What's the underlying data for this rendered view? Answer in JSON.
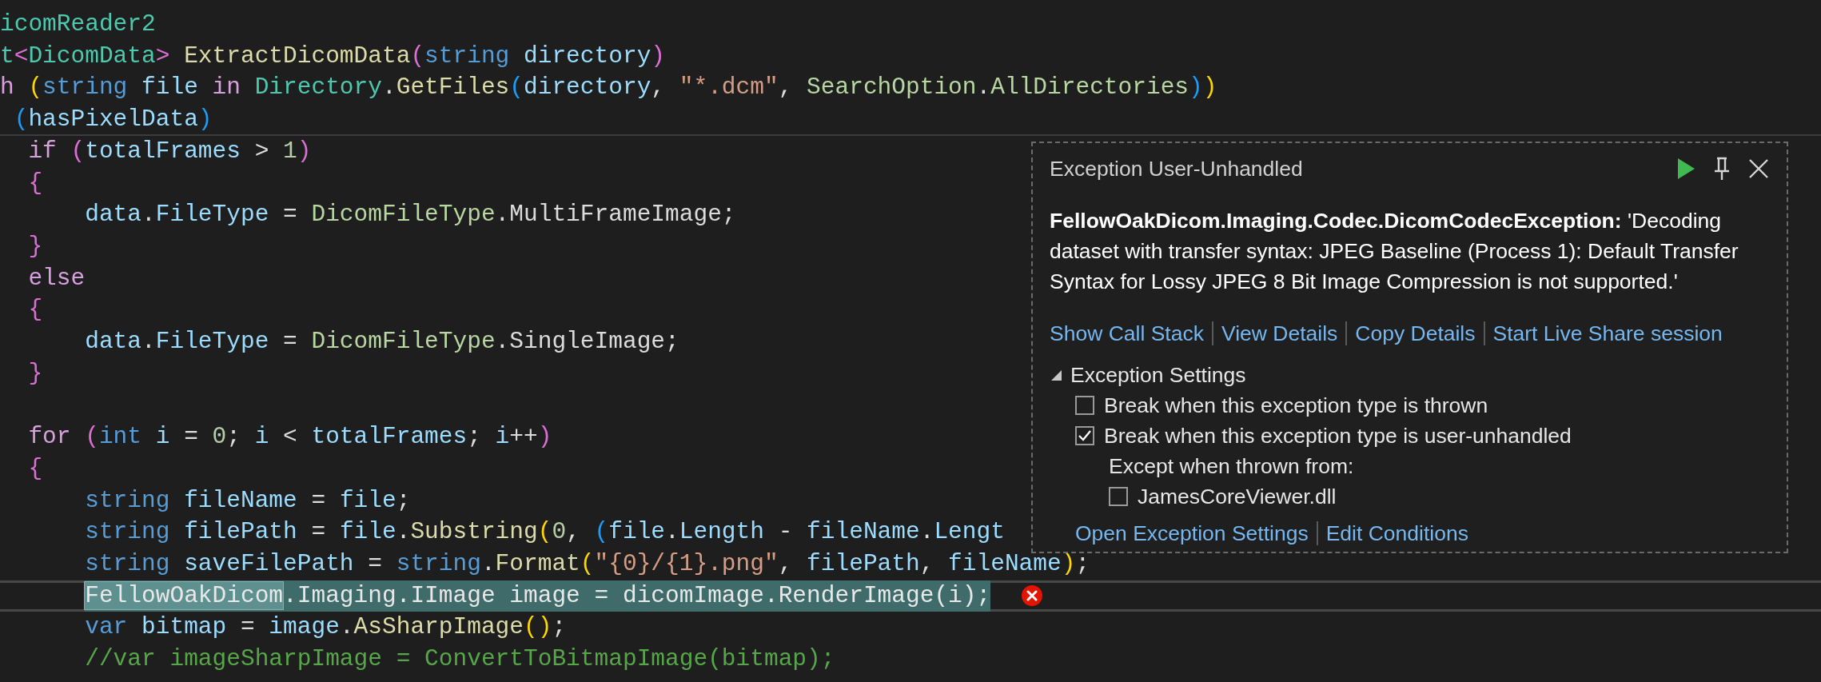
{
  "editor": {
    "sticky_lines": [
      {
        "tokens": [
          {
            "text": "icomReader2",
            "kind": "type"
          }
        ]
      },
      {
        "tokens": [
          {
            "text": "t",
            "kind": "type"
          },
          {
            "text": "<",
            "kind": "bracket1"
          },
          {
            "text": "DicomData",
            "kind": "type"
          },
          {
            "text": ">",
            "kind": "bracket1"
          },
          {
            "text": " ExtractDicomData",
            "kind": "method"
          },
          {
            "text": "(",
            "kind": "bracket1"
          },
          {
            "text": "string",
            "kind": "keyword"
          },
          {
            "text": " directory",
            "kind": "variable"
          },
          {
            "text": ")",
            "kind": "bracket1"
          }
        ]
      },
      {
        "tokens": [
          {
            "text": "h",
            "kind": "control"
          },
          {
            "text": " (",
            "kind": "bracket3"
          },
          {
            "text": "string",
            "kind": "keyword"
          },
          {
            "text": " file ",
            "kind": "variable"
          },
          {
            "text": "in",
            "kind": "control"
          },
          {
            "text": " Directory",
            "kind": "type"
          },
          {
            "text": ".",
            "kind": "punct"
          },
          {
            "text": "GetFiles",
            "kind": "method"
          },
          {
            "text": "(",
            "kind": "bracket2"
          },
          {
            "text": "directory",
            "kind": "variable"
          },
          {
            "text": ", ",
            "kind": "punct"
          },
          {
            "text": "\"*.dcm\"",
            "kind": "string"
          },
          {
            "text": ", ",
            "kind": "punct"
          },
          {
            "text": "SearchOption",
            "kind": "enum"
          },
          {
            "text": ".",
            "kind": "punct"
          },
          {
            "text": "AllDirectories",
            "kind": "enum"
          },
          {
            "text": ")",
            "kind": "bracket2"
          },
          {
            "text": ")",
            "kind": "bracket3"
          }
        ]
      },
      {
        "tokens": [
          {
            "text": " (",
            "kind": "bracket2"
          },
          {
            "text": "hasPixelData",
            "kind": "variable"
          },
          {
            "text": ")",
            "kind": "bracket2"
          }
        ]
      }
    ],
    "lines": [
      {
        "highlighted": false,
        "error": false,
        "tokens": [
          {
            "text": "  if",
            "kind": "control"
          },
          {
            "text": " (",
            "kind": "bracket1"
          },
          {
            "text": "totalFrames",
            "kind": "variable"
          },
          {
            "text": " > ",
            "kind": "punct"
          },
          {
            "text": "1",
            "kind": "number"
          },
          {
            "text": ")",
            "kind": "bracket1"
          }
        ]
      },
      {
        "highlighted": false,
        "error": false,
        "tokens": [
          {
            "text": "  {",
            "kind": "bracket1"
          }
        ]
      },
      {
        "highlighted": false,
        "error": false,
        "tokens": [
          {
            "text": "      data",
            "kind": "variable"
          },
          {
            "text": ".",
            "kind": "punct"
          },
          {
            "text": "FileType",
            "kind": "variable"
          },
          {
            "text": " = ",
            "kind": "punct"
          },
          {
            "text": "DicomFileType",
            "kind": "enum"
          },
          {
            "text": ".",
            "kind": "punct"
          },
          {
            "text": "MultiFrameImage",
            "kind": "punct"
          },
          {
            "text": ";",
            "kind": "punct"
          }
        ]
      },
      {
        "highlighted": false,
        "error": false,
        "tokens": [
          {
            "text": "  }",
            "kind": "bracket1"
          }
        ]
      },
      {
        "highlighted": false,
        "error": false,
        "tokens": [
          {
            "text": "  else",
            "kind": "control"
          }
        ]
      },
      {
        "highlighted": false,
        "error": false,
        "tokens": [
          {
            "text": "  {",
            "kind": "bracket1"
          }
        ]
      },
      {
        "highlighted": false,
        "error": false,
        "tokens": [
          {
            "text": "      data",
            "kind": "variable"
          },
          {
            "text": ".",
            "kind": "punct"
          },
          {
            "text": "FileType",
            "kind": "variable"
          },
          {
            "text": " = ",
            "kind": "punct"
          },
          {
            "text": "DicomFileType",
            "kind": "enum"
          },
          {
            "text": ".",
            "kind": "punct"
          },
          {
            "text": "SingleImage",
            "kind": "punct"
          },
          {
            "text": ";",
            "kind": "punct"
          }
        ]
      },
      {
        "highlighted": false,
        "error": false,
        "tokens": [
          {
            "text": "  }",
            "kind": "bracket1"
          }
        ]
      },
      {
        "highlighted": false,
        "error": false
      },
      {
        "highlighted": false,
        "error": false,
        "tokens": [
          {
            "text": "  for",
            "kind": "control"
          },
          {
            "text": " (",
            "kind": "bracket1"
          },
          {
            "text": "int",
            "kind": "keyword"
          },
          {
            "text": " i",
            "kind": "variable"
          },
          {
            "text": " = ",
            "kind": "punct"
          },
          {
            "text": "0",
            "kind": "number"
          },
          {
            "text": "; ",
            "kind": "punct"
          },
          {
            "text": "i",
            "kind": "variable"
          },
          {
            "text": " < ",
            "kind": "punct"
          },
          {
            "text": "totalFrames",
            "kind": "variable"
          },
          {
            "text": "; ",
            "kind": "punct"
          },
          {
            "text": "i",
            "kind": "variable"
          },
          {
            "text": "++",
            "kind": "punct"
          },
          {
            "text": ")",
            "kind": "bracket1"
          }
        ]
      },
      {
        "highlighted": false,
        "error": false,
        "tokens": [
          {
            "text": "  {",
            "kind": "bracket1"
          }
        ]
      },
      {
        "highlighted": false,
        "error": false,
        "tokens": [
          {
            "text": "      string",
            "kind": "keyword"
          },
          {
            "text": " fileName",
            "kind": "variable"
          },
          {
            "text": " = ",
            "kind": "punct"
          },
          {
            "text": "file",
            "kind": "variable"
          },
          {
            "text": ";",
            "kind": "punct"
          }
        ]
      },
      {
        "highlighted": false,
        "error": false,
        "tokens": [
          {
            "text": "      string",
            "kind": "keyword"
          },
          {
            "text": " filePath",
            "kind": "variable"
          },
          {
            "text": " = ",
            "kind": "punct"
          },
          {
            "text": "file",
            "kind": "variable"
          },
          {
            "text": ".",
            "kind": "punct"
          },
          {
            "text": "Substring",
            "kind": "method"
          },
          {
            "text": "(",
            "kind": "bracket3"
          },
          {
            "text": "0",
            "kind": "number"
          },
          {
            "text": ", ",
            "kind": "punct"
          },
          {
            "text": "(",
            "kind": "bracket2"
          },
          {
            "text": "file",
            "kind": "variable"
          },
          {
            "text": ".",
            "kind": "punct"
          },
          {
            "text": "Length",
            "kind": "variable"
          },
          {
            "text": " - ",
            "kind": "punct"
          },
          {
            "text": "fileName",
            "kind": "variable"
          },
          {
            "text": ".",
            "kind": "punct"
          },
          {
            "text": "Lengt",
            "kind": "variable"
          }
        ]
      },
      {
        "highlighted": false,
        "error": false,
        "tokens": [
          {
            "text": "      string",
            "kind": "keyword"
          },
          {
            "text": " saveFilePath",
            "kind": "variable"
          },
          {
            "text": " = ",
            "kind": "punct"
          },
          {
            "text": "string",
            "kind": "keyword"
          },
          {
            "text": ".",
            "kind": "punct"
          },
          {
            "text": "Format",
            "kind": "method"
          },
          {
            "text": "(",
            "kind": "bracket3"
          },
          {
            "text": "\"{0}/{1}.png\"",
            "kind": "string"
          },
          {
            "text": ", ",
            "kind": "punct"
          },
          {
            "text": "filePath",
            "kind": "variable"
          },
          {
            "text": ", ",
            "kind": "punct"
          },
          {
            "text": "fileName",
            "kind": "variable"
          },
          {
            "text": ")",
            "kind": "bracket3"
          },
          {
            "text": ";",
            "kind": "punct"
          }
        ]
      },
      {
        "highlighted": true,
        "error": true,
        "tokens": [
          {
            "text": "      FellowOakDicom",
            "kind": "selection"
          },
          {
            "text": ".Imaging.IImage image = dicomImage.RenderImage(i);",
            "kind": "plain"
          }
        ]
      },
      {
        "highlighted": false,
        "error": false,
        "tokens": [
          {
            "text": "      var",
            "kind": "keyword"
          },
          {
            "text": " bitmap",
            "kind": "variable"
          },
          {
            "text": " = ",
            "kind": "punct"
          },
          {
            "text": "image",
            "kind": "variable"
          },
          {
            "text": ".",
            "kind": "punct"
          },
          {
            "text": "AsSharpImage",
            "kind": "method"
          },
          {
            "text": "(",
            "kind": "bracket3"
          },
          {
            "text": ")",
            "kind": "bracket3"
          },
          {
            "text": ";",
            "kind": "punct"
          }
        ]
      },
      {
        "highlighted": false,
        "error": false,
        "tokens": [
          {
            "text": "      //var imageSharpImage = ConvertToBitmapImage(bitmap);",
            "kind": "comment"
          }
        ]
      }
    ]
  },
  "exception_popup": {
    "title": "Exception User-Unhandled",
    "message": "**FellowOakDicom.Imaging.Codec.DicomCodecException:** 'Decoding dataset with transfer syntax: JPEG Baseline (Process 1): Default Transfer Syntax for Lossy JPEG 8 Bit Image Compression is not supported.'",
    "links": [
      "Show Call Stack",
      "View Details",
      "Copy Details",
      "Start Live Share session"
    ],
    "settings": {
      "label": "Exception Settings",
      "expanded": true,
      "options": [
        {
          "label": "Break when this exception type is thrown",
          "checked": false
        },
        {
          "label": "Break when this exception type is user-unhandled",
          "checked": true
        }
      ],
      "except_label": "Except when thrown from:",
      "modules": [
        {
          "label": "JamesCoreViewer.dll",
          "checked": false
        }
      ]
    },
    "footer_links": [
      "Open Exception Settings",
      "Edit Conditions"
    ]
  }
}
